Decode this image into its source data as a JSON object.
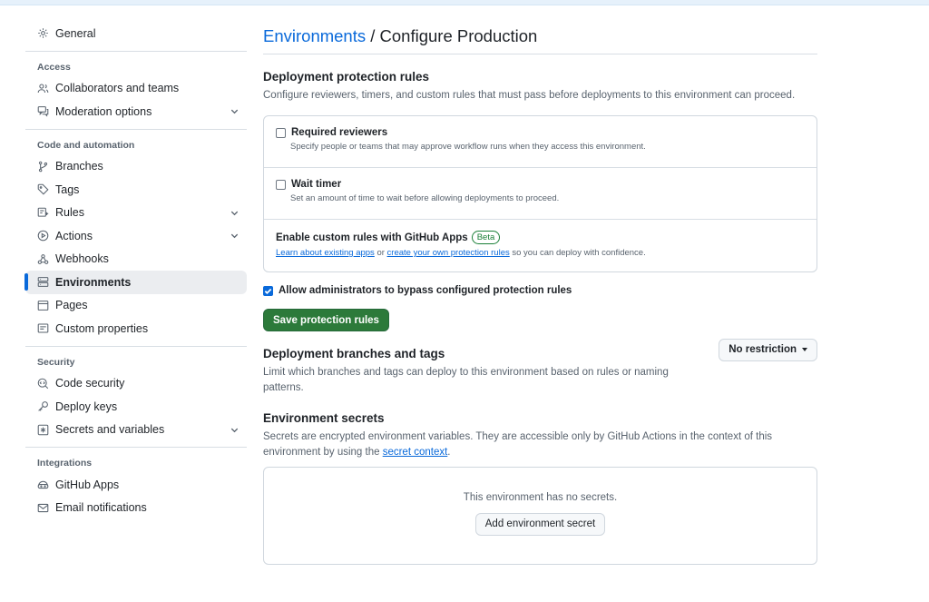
{
  "sidebar": {
    "general": "General",
    "access_heading": "Access",
    "access": [
      {
        "label": "Collaborators and teams"
      },
      {
        "label": "Moderation options"
      }
    ],
    "code_heading": "Code and automation",
    "code": [
      {
        "label": "Branches"
      },
      {
        "label": "Tags"
      },
      {
        "label": "Rules"
      },
      {
        "label": "Actions"
      },
      {
        "label": "Webhooks"
      },
      {
        "label": "Environments"
      },
      {
        "label": "Pages"
      },
      {
        "label": "Custom properties"
      }
    ],
    "security_heading": "Security",
    "security": [
      {
        "label": "Code security"
      },
      {
        "label": "Deploy keys"
      },
      {
        "label": "Secrets and variables"
      }
    ],
    "integrations_heading": "Integrations",
    "integrations": [
      {
        "label": "GitHub Apps"
      },
      {
        "label": "Email notifications"
      }
    ]
  },
  "header": {
    "breadcrumb_link": "Environments",
    "breadcrumb_rest": " / Configure Production"
  },
  "protection": {
    "title": "Deployment protection rules",
    "description": "Configure reviewers, timers, and custom rules that must pass before deployments to this environment can proceed.",
    "required_reviewers": {
      "title": "Required reviewers",
      "description": "Specify people or teams that may approve workflow runs when they access this environment."
    },
    "wait_timer": {
      "title": "Wait timer",
      "description": "Set an amount of time to wait before allowing deployments to proceed."
    },
    "custom_rules": {
      "title": "Enable custom rules with GitHub Apps",
      "badge": "Beta",
      "link1": "Learn about existing apps",
      "or": " or ",
      "link2": "create your own protection rules",
      "suffix": " so you can deploy with confidence."
    },
    "bypass_label": "Allow administrators to bypass configured protection rules",
    "save_label": "Save protection rules"
  },
  "branches": {
    "title": "Deployment branches and tags",
    "description": "Limit which branches and tags can deploy to this environment based on rules or naming patterns.",
    "dropdown_value": "No restriction"
  },
  "secrets": {
    "title": "Environment secrets",
    "description_pre": "Secrets are encrypted environment variables. They are accessible only by GitHub Actions in the context of this environment by using the ",
    "description_link": "secret context",
    "description_post": ".",
    "empty_text": "This environment has no secrets.",
    "add_label": "Add environment secret"
  }
}
